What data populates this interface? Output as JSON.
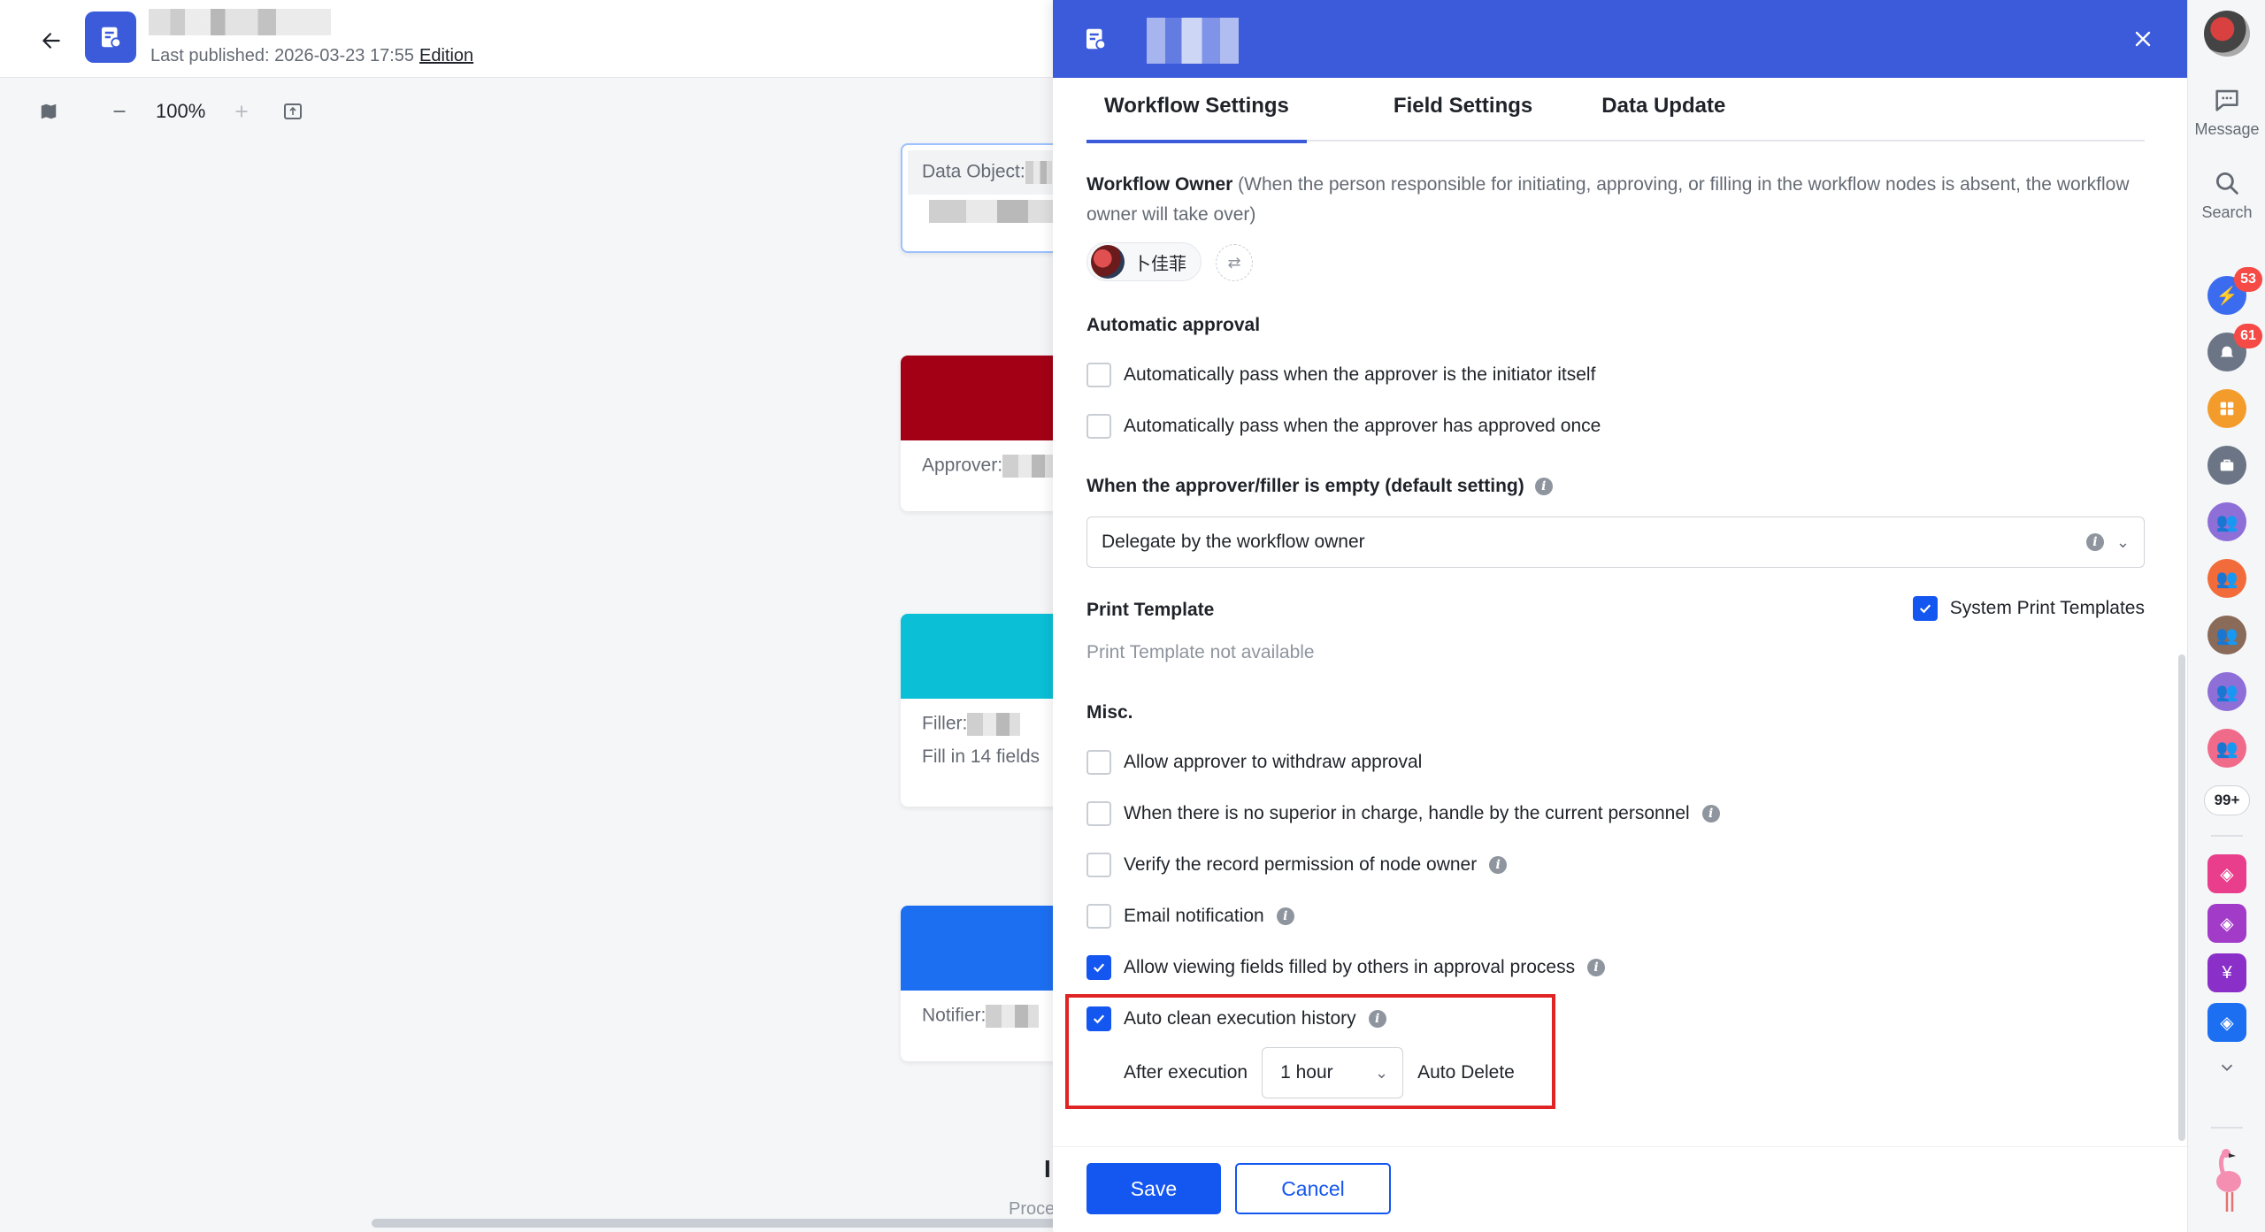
{
  "editor": {
    "published_label": "Last published: 2026-03-23 17:55",
    "edition_label": "Edition",
    "zoom_level": "100%",
    "nodes": [
      {
        "label": "Data Object:",
        "color": "#ffffff"
      },
      {
        "label": "Approver:",
        "color": "#a30016"
      },
      {
        "label": "Filler:",
        "sub": "Fill in 14 fields",
        "color": "#0abfd6"
      },
      {
        "label": "Notifier:",
        "color": "#1d6ff2"
      }
    ],
    "bottom_fragment_1": "I",
    "bottom_fragment_2": "Proce"
  },
  "drawer": {
    "tabs": [
      "Workflow Settings",
      "Field Settings",
      "Data Update"
    ],
    "active_tab": 0,
    "workflow_owner": {
      "title": "Workflow Owner",
      "description": "(When the person responsible for initiating, approving, or filling in the workflow nodes is absent, the workflow owner will take over)",
      "owner_name": "卜佳菲"
    },
    "automatic_approval": {
      "title": "Automatic approval",
      "options": [
        {
          "label": "Automatically pass when the approver is the initiator itself",
          "checked": false
        },
        {
          "label": "Automatically pass when the approver has approved once",
          "checked": false
        }
      ]
    },
    "empty_approver": {
      "title": "When the approver/filler is empty (default setting)",
      "selected": "Delegate by the workflow owner"
    },
    "print_template": {
      "title": "Print Template",
      "system_label": "System Print Templates",
      "system_checked": true,
      "empty_text": "Print Template not available"
    },
    "misc": {
      "title": "Misc.",
      "options": [
        {
          "label": "Allow approver to withdraw approval",
          "checked": false,
          "info": false
        },
        {
          "label": "When there is no superior in charge, handle by the current personnel",
          "checked": false,
          "info": true
        },
        {
          "label": "Verify the record permission of node owner",
          "checked": false,
          "info": true
        },
        {
          "label": "Email notification",
          "checked": false,
          "info": true
        },
        {
          "label": "Allow viewing fields filled by others in approval process",
          "checked": true,
          "info": true
        },
        {
          "label": "Auto clean execution history",
          "checked": true,
          "info": true
        }
      ]
    },
    "auto_clean": {
      "prefix": "After execution",
      "duration": "1 hour",
      "suffix": "Auto Delete"
    },
    "buttons": {
      "save": "Save",
      "cancel": "Cancel"
    }
  },
  "rail": {
    "message_label": "Message",
    "search_label": "Search",
    "badge_1": "53",
    "badge_2": "61",
    "more_label": "99+"
  },
  "colors": {
    "brand": "#3b5bdb",
    "primary": "#1456f0",
    "highlight": "#e02424"
  }
}
